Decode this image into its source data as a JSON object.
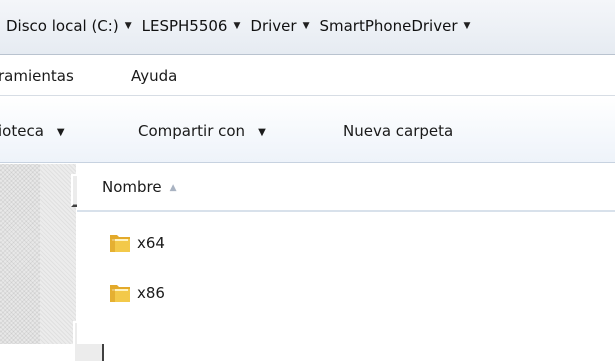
{
  "addressbar": {
    "crumbs": [
      "Disco local (C:)",
      "LESPH5506",
      "Driver",
      "SmartPhoneDriver"
    ]
  },
  "menubar": {
    "items": [
      "ramientas",
      "Ayuda"
    ]
  },
  "commandbar": {
    "library": "ioteca",
    "share": "Compartir con",
    "new_folder": "Nueva carpeta"
  },
  "filelist": {
    "column_name": "Nombre",
    "items": [
      {
        "name": "x64",
        "icon": "folder-icon"
      },
      {
        "name": "x86",
        "icon": "folder-icon"
      }
    ]
  },
  "colors": {
    "folder_yellow": "#f3c94a",
    "header_border": "#d8e1eb",
    "sort_arrow": "#a9b3c2"
  }
}
